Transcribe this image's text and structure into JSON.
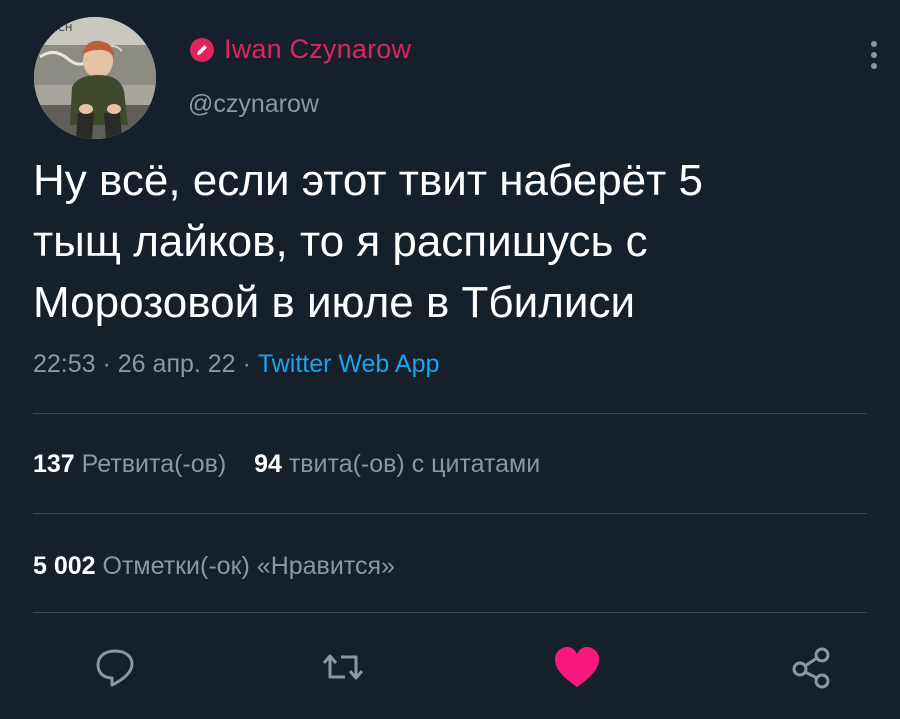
{
  "author": {
    "display_name": "Iwan Czynarow",
    "handle": "@czynarow"
  },
  "tweet": {
    "text": "Ну всё, если этот твит наберёт 5\nтыщ лайков, то я распишусь с\nМорозовой в июле в Тбилиси",
    "time": "22:53",
    "date": "26 апр. 22",
    "separator": " · ",
    "source": "Twitter Web App"
  },
  "stats": {
    "retweets_count": "137",
    "retweets_label": "Ретвита(-ов)",
    "quotes_count": "94",
    "quotes_label": "твита(-ов) с цитатами",
    "likes_count": "5 002",
    "likes_label": "Отметки(-ок) «Нравится»"
  },
  "actions": {
    "reply_icon": "reply-icon",
    "retweet_icon": "retweet-icon",
    "like_icon": "heart-icon",
    "share_icon": "share-icon"
  },
  "colors": {
    "background": "#15202b",
    "name": "#e0245e",
    "muted": "#8899a6",
    "link": "#1da1f2",
    "like_active": "#f91880"
  }
}
